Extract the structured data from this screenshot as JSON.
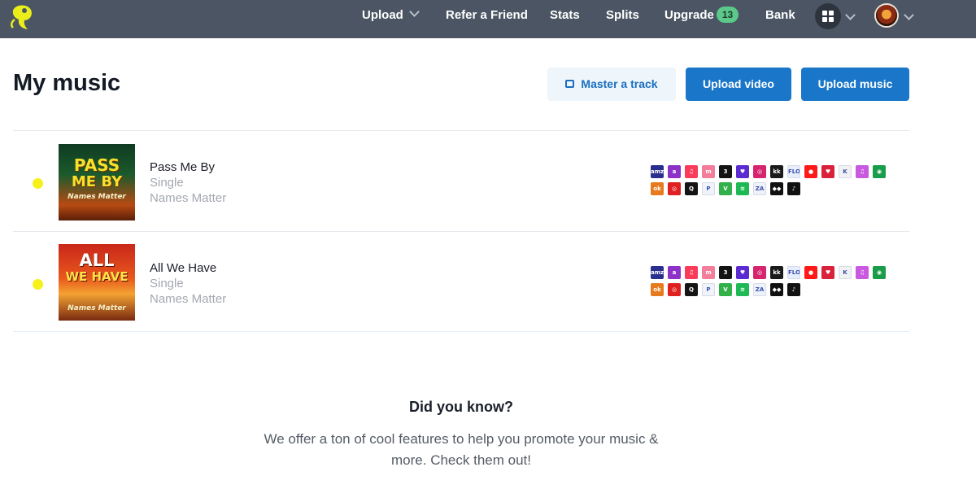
{
  "nav": {
    "upload": "Upload",
    "refer": "Refer a Friend",
    "stats": "Stats",
    "splits": "Splits",
    "upgrade": "Upgrade",
    "upgrade_badge": "13",
    "bank": "Bank"
  },
  "page": {
    "title": "My music",
    "master_label": "Master a track",
    "upload_video_label": "Upload video",
    "upload_music_label": "Upload music"
  },
  "tracks": [
    {
      "title": "Pass Me By",
      "type": "Single",
      "artist": "Names Matter",
      "cover_lines": [
        "PASS",
        "ME BY"
      ],
      "cover_sub": "Names Matter"
    },
    {
      "title": "All We Have",
      "type": "Single",
      "artist": "Names Matter",
      "cover_lines": [
        "ALL",
        "WE HAVE"
      ],
      "cover_sub": "Names Matter"
    }
  ],
  "stores": [
    {
      "name": "amazon-music-icon",
      "color": "#2a2f8f",
      "glyph": "amz"
    },
    {
      "name": "anghami-icon",
      "color": "#8d32c9",
      "glyph": "a"
    },
    {
      "name": "apple-music-icon",
      "color": "#fa3c5a",
      "glyph": "♫"
    },
    {
      "name": "boomplay-icon",
      "color": "#f37d9a",
      "glyph": "m"
    },
    {
      "name": "audiomack-icon",
      "color": "#141414",
      "glyph": "3"
    },
    {
      "name": "deezer-icon",
      "color": "#5b2bd1",
      "glyph": "♥"
    },
    {
      "name": "instagram-icon",
      "color": "#d6246f",
      "glyph": "◎"
    },
    {
      "name": "kkbox-icon",
      "color": "#1a1a1a",
      "glyph": "kk"
    },
    {
      "name": "flo-icon",
      "color": "#e8eefc",
      "glyph": "FLO"
    },
    {
      "name": "youtube-music-icon",
      "color": "#ff1a1a",
      "glyph": "●"
    },
    {
      "name": "iheartradio-icon",
      "color": "#d9213b",
      "glyph": "♥"
    },
    {
      "name": "kuack-icon",
      "color": "#f2f2f2",
      "glyph": "K"
    },
    {
      "name": "itunes-icon",
      "color": "#c95ae0",
      "glyph": "♫"
    },
    {
      "name": "napster-icon",
      "color": "#1a9d4b",
      "glyph": "◉"
    },
    {
      "name": "ok-icon",
      "color": "#e77a1d",
      "glyph": "ok"
    },
    {
      "name": "netease-icon",
      "color": "#e02020",
      "glyph": "◎"
    },
    {
      "name": "qobuz-icon",
      "color": "#151515",
      "glyph": "Q"
    },
    {
      "name": "pandora-icon",
      "color": "#f0f4fa",
      "glyph": "P"
    },
    {
      "name": "joox-icon",
      "color": "#32b04a",
      "glyph": "V"
    },
    {
      "name": "spotify-icon",
      "color": "#1db954",
      "glyph": "≋"
    },
    {
      "name": "saavn-icon",
      "color": "#eef2fb",
      "glyph": "ZA"
    },
    {
      "name": "tidal-icon",
      "color": "#111111",
      "glyph": "◆◆"
    },
    {
      "name": "tiktok-icon",
      "color": "#111111",
      "glyph": "♪"
    }
  ],
  "did_you_know": {
    "title": "Did you know?",
    "text": "We offer a ton of cool features to help you promote your music & more. Check them out!"
  }
}
